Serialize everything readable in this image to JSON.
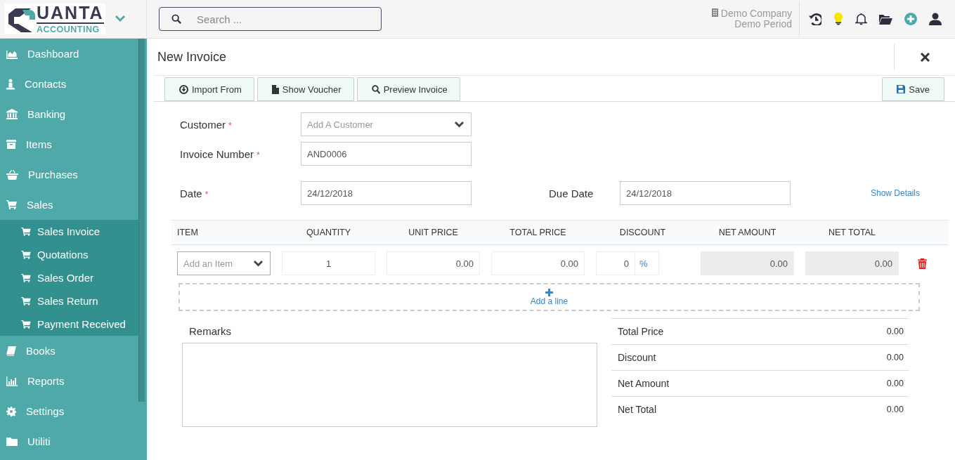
{
  "header": {
    "logo": {
      "word": "UANTA",
      "tagline": "ACCOUNTING"
    },
    "search": {
      "placeholder": "Search ..."
    },
    "company": "Demo Company",
    "period": "Demo Period"
  },
  "sidebar": {
    "items": [
      {
        "label": "Dashboard"
      },
      {
        "label": "Contacts"
      },
      {
        "label": "Banking"
      },
      {
        "label": "Items"
      },
      {
        "label": "Purchases"
      },
      {
        "label": "Sales",
        "expanded": true,
        "children": [
          {
            "label": "Sales Invoice"
          },
          {
            "label": "Quotations"
          },
          {
            "label": "Sales Order"
          },
          {
            "label": "Sales Return"
          },
          {
            "label": "Payment Received"
          }
        ]
      },
      {
        "label": "Books"
      },
      {
        "label": "Reports"
      },
      {
        "label": "Settings"
      },
      {
        "label": "Utiliti"
      }
    ]
  },
  "page": {
    "title": "New Invoice",
    "toolbar": [
      {
        "label": "Import From"
      },
      {
        "label": "Show Voucher"
      },
      {
        "label": "Preview Invoice"
      }
    ],
    "save": "Save"
  },
  "form": {
    "fields": [
      {
        "label": "Customer",
        "required_mark": "*",
        "kind": "select",
        "placeholder": "Add A Customer"
      },
      {
        "label": "Invoice Number",
        "required_mark": "*",
        "kind": "text",
        "value": "AND0006"
      },
      {
        "label": "Date",
        "required_mark": "*",
        "kind": "text",
        "value": "24/12/2018"
      }
    ],
    "due_date": {
      "label": "Due Date",
      "value": "24/12/2018"
    },
    "show_details": "Show Details"
  },
  "table": {
    "columns": [
      "ITEM",
      "QUANTITY",
      "UNIT PRICE",
      "TOTAL PRICE",
      "DISCOUNT",
      "NET AMOUNT",
      "NET TOTAL"
    ],
    "rows": [
      {
        "cells": [
          {
            "kind": "select",
            "placeholder": "Add an Item"
          },
          {
            "kind": "count",
            "value": "1"
          },
          {
            "kind": "amount",
            "value": "0.00"
          },
          {
            "kind": "amount",
            "value": "0.00"
          },
          {
            "kind": "percent",
            "value": "0",
            "unit": "%"
          },
          {
            "kind": "amount",
            "value": "0.00",
            "disabled": true
          },
          {
            "kind": "amount",
            "value": "0.00",
            "disabled": true
          }
        ]
      }
    ]
  },
  "add_line": "Add a line",
  "remarks": {
    "label": "Remarks"
  },
  "summary": [
    {
      "label": "Total Price",
      "value": "0.00"
    },
    {
      "label": "Discount",
      "value": "0.00"
    },
    {
      "label": "Net Amount",
      "value": "0.00"
    },
    {
      "label": "Net Total",
      "value": "0.00"
    }
  ]
}
